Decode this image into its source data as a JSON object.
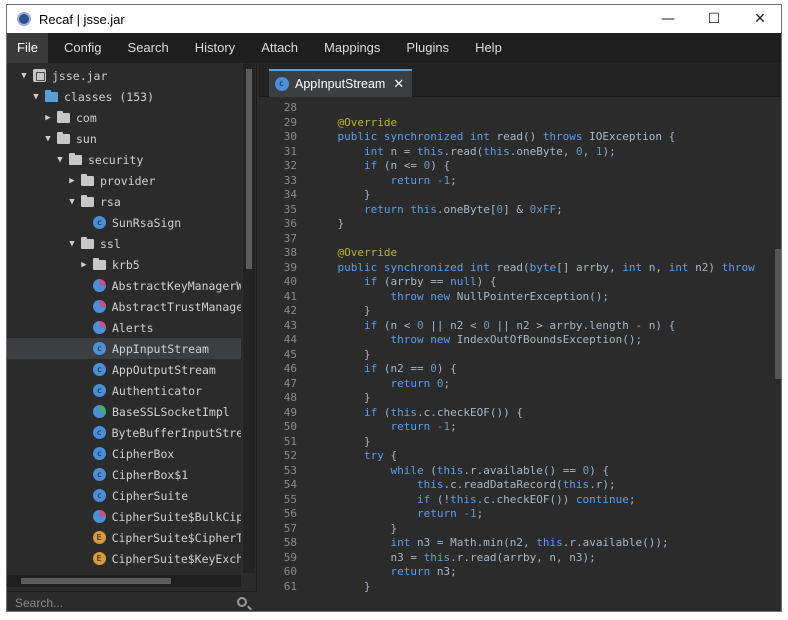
{
  "window": {
    "title": "Recaf | jsse.jar"
  },
  "window_controls": {
    "minimize": "—",
    "maximize": "☐",
    "close": "✕"
  },
  "menu": [
    "File",
    "Config",
    "Search",
    "History",
    "Attach",
    "Mappings",
    "Plugins",
    "Help"
  ],
  "tree": [
    {
      "label": "jsse.jar",
      "indent": 0,
      "arrow": "▼",
      "icon": "jar"
    },
    {
      "label": "classes (153)",
      "indent": 1,
      "arrow": "▼",
      "icon": "folder-blue"
    },
    {
      "label": "com",
      "indent": 2,
      "arrow": "▶",
      "icon": "folder"
    },
    {
      "label": "sun",
      "indent": 2,
      "arrow": "▼",
      "icon": "folder"
    },
    {
      "label": "security",
      "indent": 3,
      "arrow": "▼",
      "icon": "folder"
    },
    {
      "label": "provider",
      "indent": 4,
      "arrow": "▶",
      "icon": "folder"
    },
    {
      "label": "rsa",
      "indent": 4,
      "arrow": "▼",
      "icon": "folder"
    },
    {
      "label": "SunRsaSign",
      "indent": 5,
      "arrow": "",
      "icon": "class"
    },
    {
      "label": "ssl",
      "indent": 4,
      "arrow": "▼",
      "icon": "folder"
    },
    {
      "label": "krb5",
      "indent": 5,
      "arrow": "▶",
      "icon": "folder"
    },
    {
      "label": "AbstractKeyManagerWra",
      "indent": 5,
      "arrow": "",
      "icon": "class-mix"
    },
    {
      "label": "AbstractTrustManagerW",
      "indent": 5,
      "arrow": "",
      "icon": "class-mix"
    },
    {
      "label": "Alerts",
      "indent": 5,
      "arrow": "",
      "icon": "class-mix"
    },
    {
      "label": "AppInputStream",
      "indent": 5,
      "arrow": "",
      "icon": "class",
      "selected": true
    },
    {
      "label": "AppOutputStream",
      "indent": 5,
      "arrow": "",
      "icon": "class"
    },
    {
      "label": "Authenticator",
      "indent": 5,
      "arrow": "",
      "icon": "class"
    },
    {
      "label": "BaseSSLSocketImpl",
      "indent": 5,
      "arrow": "",
      "icon": "class-green"
    },
    {
      "label": "ByteBufferInputStream",
      "indent": 5,
      "arrow": "",
      "icon": "class"
    },
    {
      "label": "CipherBox",
      "indent": 5,
      "arrow": "",
      "icon": "class"
    },
    {
      "label": "CipherBox$1",
      "indent": 5,
      "arrow": "",
      "icon": "class"
    },
    {
      "label": "CipherSuite",
      "indent": 5,
      "arrow": "",
      "icon": "class"
    },
    {
      "label": "CipherSuite$BulkCiphe",
      "indent": 5,
      "arrow": "",
      "icon": "class-mix"
    },
    {
      "label": "CipherSuite$CipherTyp",
      "indent": 5,
      "arrow": "",
      "icon": "enum"
    },
    {
      "label": "CipherSuite$KeyExchan",
      "indent": 5,
      "arrow": "",
      "icon": "enum"
    }
  ],
  "search": {
    "placeholder": "Search..."
  },
  "tab": {
    "label": "AppInputStream",
    "close": "✕"
  },
  "code_lines": [
    {
      "n": "28",
      "t": ""
    },
    {
      "n": "29",
      "t": "    <an>@Override</an>"
    },
    {
      "n": "30",
      "t": "    <kw>public synchronized int</kw> read() <kw>throws</kw> IOException {"
    },
    {
      "n": "31",
      "t": "        <kw>int</kw> n = <kw>this</kw>.read(<kw>this</kw>.oneByte, <num>0</num>, <num>1</num>);"
    },
    {
      "n": "32",
      "t": "        <kw>if</kw> (n &lt;= <num>0</num>) {"
    },
    {
      "n": "33",
      "t": "            <kw>return</kw> <num>-1</num>;"
    },
    {
      "n": "34",
      "t": "        }"
    },
    {
      "n": "35",
      "t": "        <kw>return</kw> <kw>this</kw>.oneByte[<num>0</num>] &amp; <num>0xFF</num>;"
    },
    {
      "n": "36",
      "t": "    }"
    },
    {
      "n": "37",
      "t": ""
    },
    {
      "n": "38",
      "t": "    <an>@Override</an>"
    },
    {
      "n": "39",
      "t": "    <kw>public synchronized int</kw> read(<kw>byte</kw>[] arrby, <kw>int</kw> n, <kw>int</kw> n2) <kw>throw</kw>"
    },
    {
      "n": "40",
      "t": "        <kw>if</kw> (arrby == <kw>null</kw>) {"
    },
    {
      "n": "41",
      "t": "            <kw>throw</kw> <kw>new</kw> NullPointerException();"
    },
    {
      "n": "42",
      "t": "        }"
    },
    {
      "n": "43",
      "t": "        <kw>if</kw> (n &lt; <num>0</num> || n2 &lt; <num>0</num> || n2 &gt; arrby.length - n) {"
    },
    {
      "n": "44",
      "t": "            <kw>throw</kw> <kw>new</kw> IndexOutOfBoundsException();"
    },
    {
      "n": "45",
      "t": "        }"
    },
    {
      "n": "46",
      "t": "        <kw>if</kw> (n2 == <num>0</num>) {"
    },
    {
      "n": "47",
      "t": "            <kw>return</kw> <num>0</num>;"
    },
    {
      "n": "48",
      "t": "        }"
    },
    {
      "n": "49",
      "t": "        <kw>if</kw> (<kw>this</kw>.c.checkEOF()) {"
    },
    {
      "n": "50",
      "t": "            <kw>return</kw> <num>-1</num>;"
    },
    {
      "n": "51",
      "t": "        }"
    },
    {
      "n": "52",
      "t": "        <kw>try</kw> {"
    },
    {
      "n": "53",
      "t": "            <kw>while</kw> (<kw>this</kw>.r.available() == <num>0</num>) {"
    },
    {
      "n": "54",
      "t": "                <kw>this</kw>.c.readDataRecord(<kw>this</kw>.r);"
    },
    {
      "n": "55",
      "t": "                <kw>if</kw> (!<kw>this</kw>.c.checkEOF()) <kw>continue</kw>;"
    },
    {
      "n": "56",
      "t": "                <kw>return</kw> <num>-1</num>;"
    },
    {
      "n": "57",
      "t": "            }"
    },
    {
      "n": "58",
      "t": "            <kw>int</kw> n3 = Math.min(n2, <kw>this</kw>.r.available());"
    },
    {
      "n": "59",
      "t": "            n3 = <kw>this</kw>.r.read(arrby, n, n3);"
    },
    {
      "n": "60",
      "t": "            <kw>return</kw> n3;"
    },
    {
      "n": "61",
      "t": "        }"
    }
  ]
}
